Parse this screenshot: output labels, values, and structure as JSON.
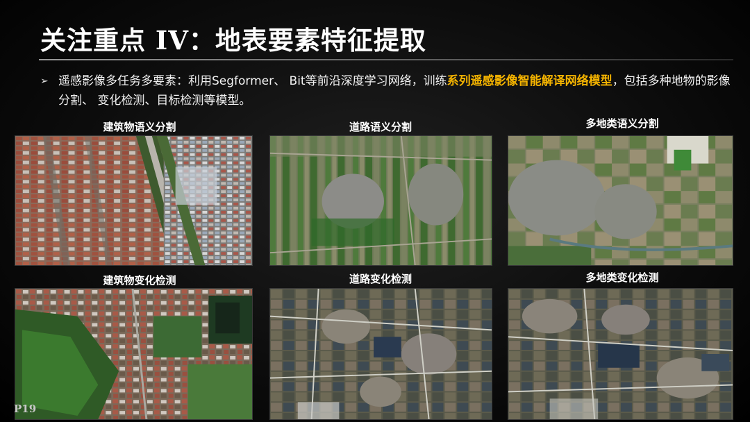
{
  "slide": {
    "title": "关注重点 IV：地表要素特征提取",
    "bullet": {
      "prefix": "遥感影像多任务多要素：利用Segformer、 Bit等前沿深度学习网络，训练",
      "highlight": "系列遥感影像智能解译网络模型",
      "suffix": "，包括多种地物的影像分割、 变化检测、目标检测等模型。"
    },
    "panels": [
      {
        "label": "建筑物语义分割"
      },
      {
        "label": "道路语义分割"
      },
      {
        "label": "多地类语义分割"
      },
      {
        "label": "建筑物变化检测"
      },
      {
        "label": "道路变化检测"
      },
      {
        "label": "多地类变化检测"
      }
    ],
    "page_number": "P19"
  },
  "colors": {
    "highlight": "#f5b400",
    "text": "#ffffff",
    "background": "#000000"
  }
}
